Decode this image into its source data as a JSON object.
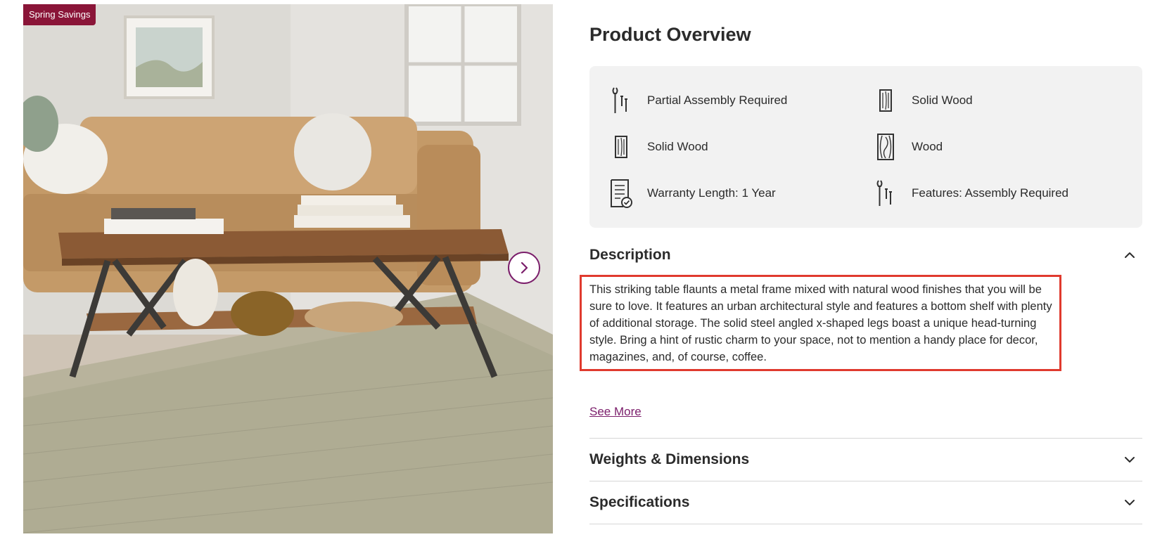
{
  "badge": {
    "label": "Spring Savings",
    "color": "#8a1538"
  },
  "gallery": {
    "next_icon": "chevron-right-icon"
  },
  "overview": {
    "title": "Product Overview",
    "features": [
      {
        "icon": "wrench-tools-icon",
        "label": "Partial Assembly Required"
      },
      {
        "icon": "wood-plank-icon",
        "label": "Solid Wood"
      },
      {
        "icon": "wood-plank-icon",
        "label": "Solid Wood"
      },
      {
        "icon": "wood-grain-icon",
        "label": "Wood"
      },
      {
        "icon": "warranty-document-icon",
        "label": "Warranty Length: 1 Year"
      },
      {
        "icon": "wrench-tools-icon",
        "label": "Features: Assembly Required"
      }
    ]
  },
  "description": {
    "title": "Description",
    "text": "This striking table flaunts a metal frame mixed with natural wood finishes that you will be sure to love. It features an urban architectural style and features a bottom shelf with plenty of additional storage. The solid steel angled x-shaped legs boast a unique head-turning style. Bring a hint of rustic charm to your space, not to mention a handy place for decor, magazines, and, of course, coffee.",
    "see_more": "See More",
    "expanded_icon": "chevron-up-icon"
  },
  "sections": [
    {
      "title": "Weights & Dimensions",
      "icon": "chevron-down-icon"
    },
    {
      "title": "Specifications",
      "icon": "chevron-down-icon"
    }
  ],
  "colors": {
    "accent": "#7b1e6b",
    "highlight": "#e03a2e",
    "card": "#f2f2f2"
  }
}
